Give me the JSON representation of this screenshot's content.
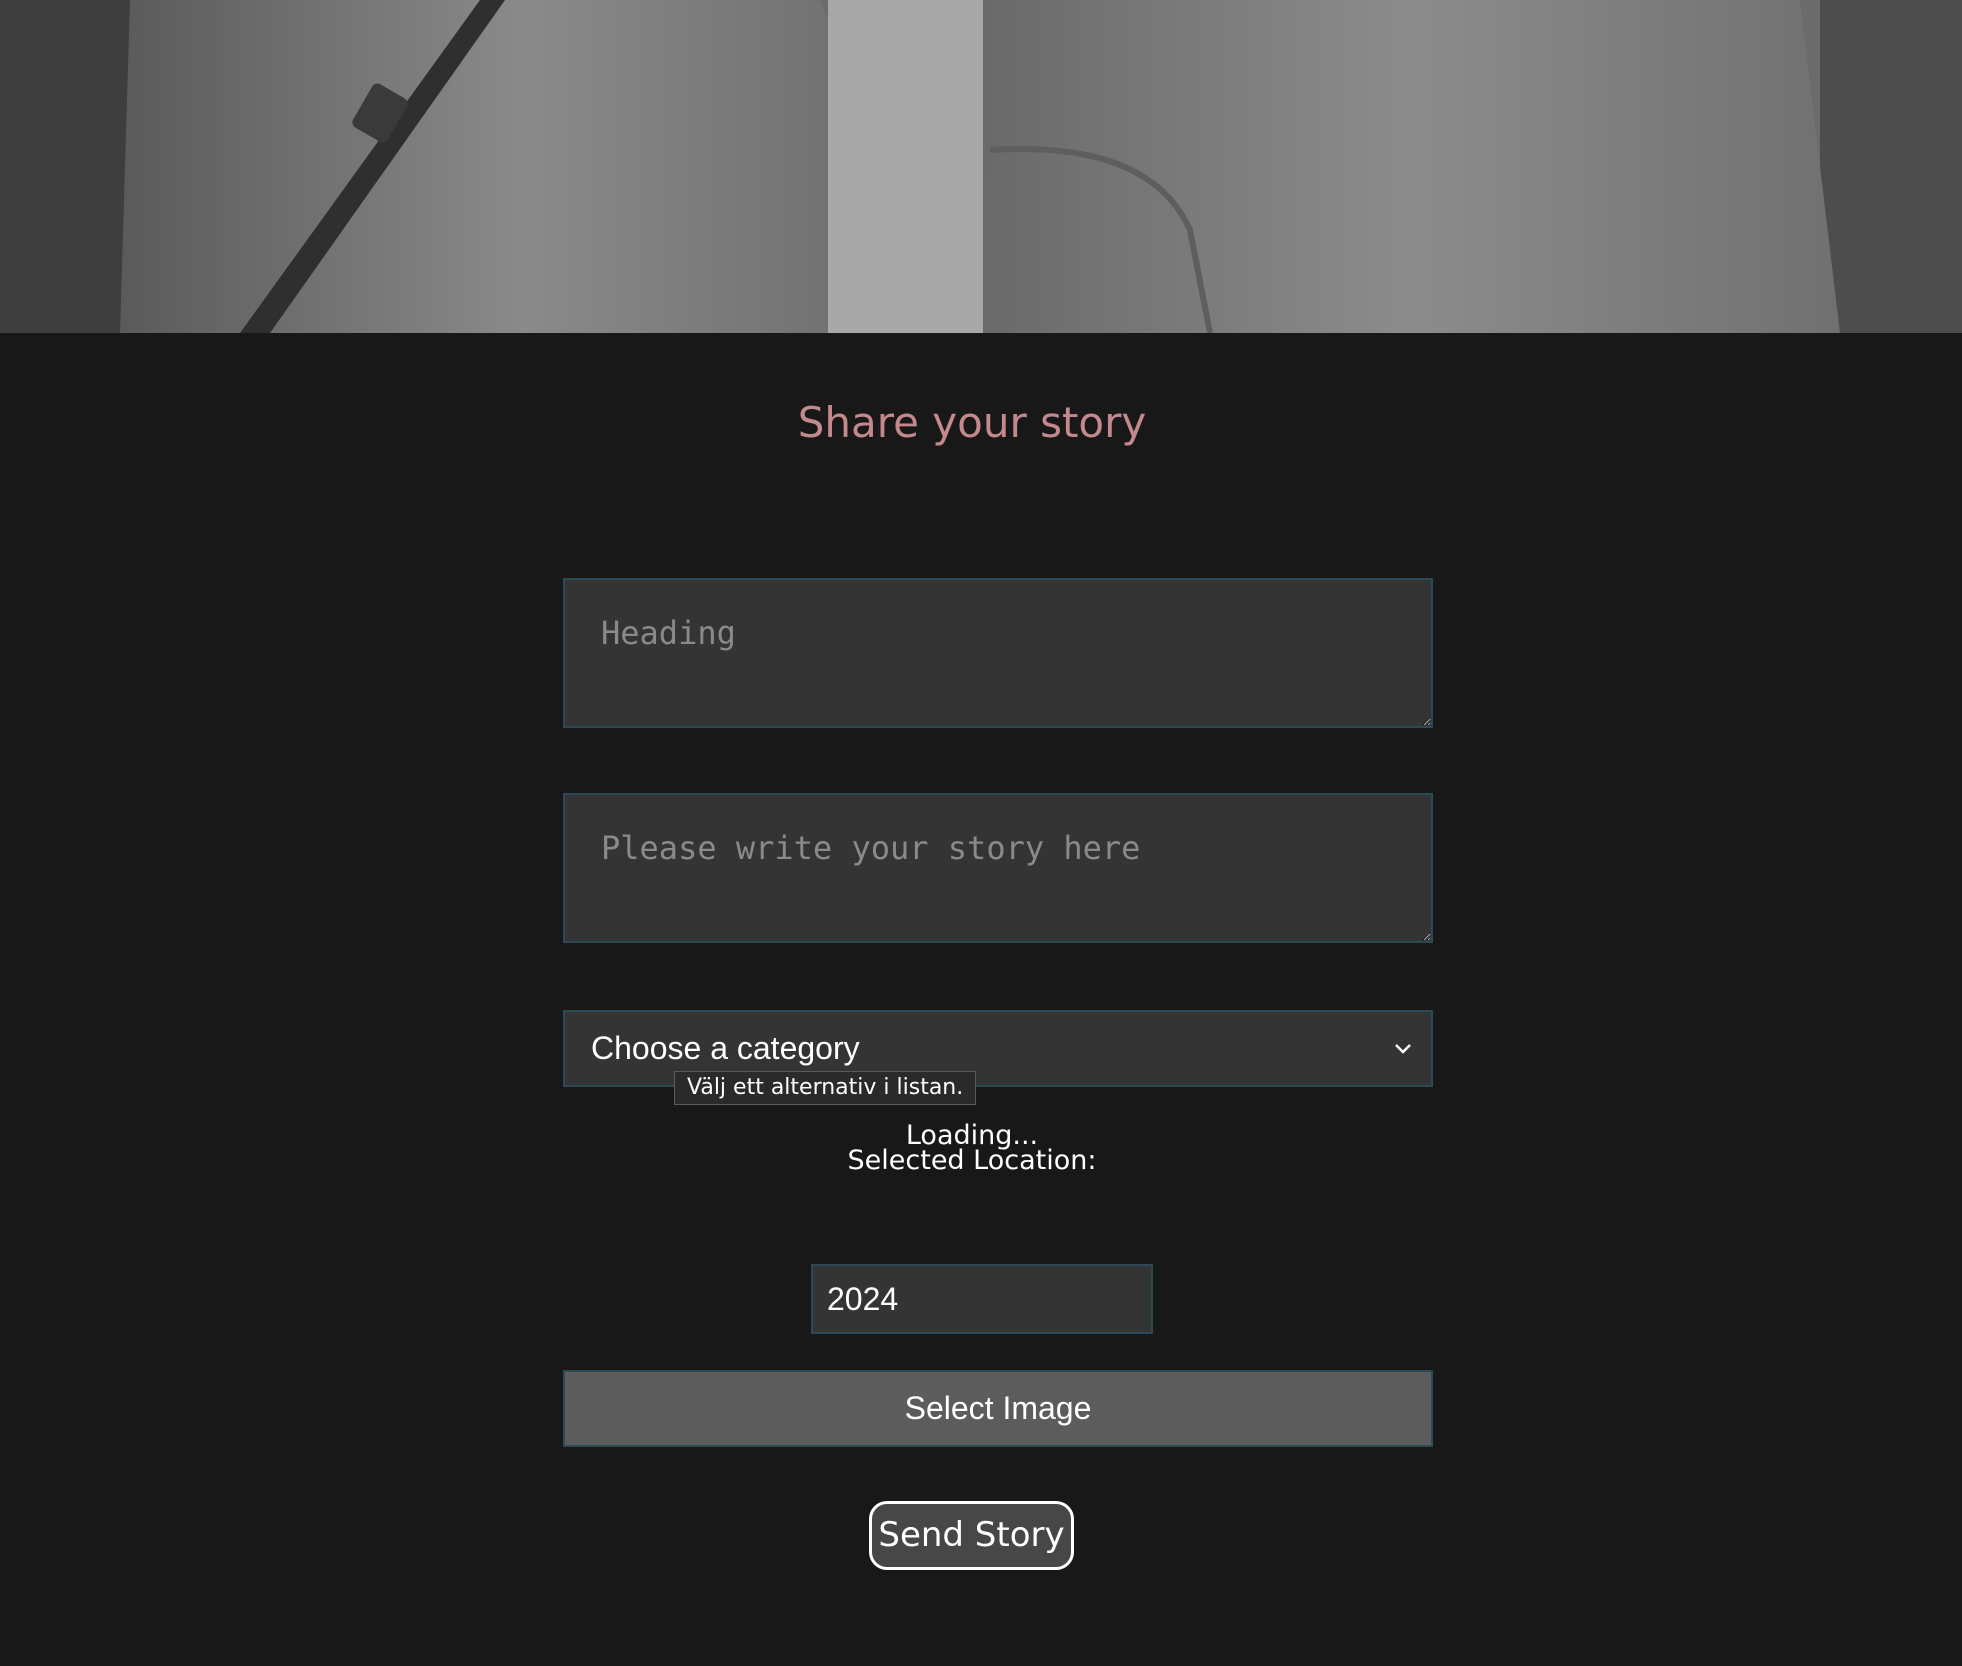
{
  "hero": {
    "image_desc_icon": "photo-banner"
  },
  "form": {
    "title": "Share your story",
    "heading_placeholder": "Heading",
    "story_placeholder": "Please write your story here",
    "category_selected": "Choose a category",
    "category_tooltip": "Välj ett alternativ i listan.",
    "loading_text": "Loading...",
    "selected_location_label": "Selected Location:",
    "year_value": "2024",
    "select_image_label": "Select Image",
    "send_label": "Send Story"
  },
  "colors": {
    "background": "#181818",
    "title": "#c4898c",
    "field_bg": "#343434",
    "field_border": "#2c4a55",
    "image_button_bg": "#5c5c5c"
  }
}
